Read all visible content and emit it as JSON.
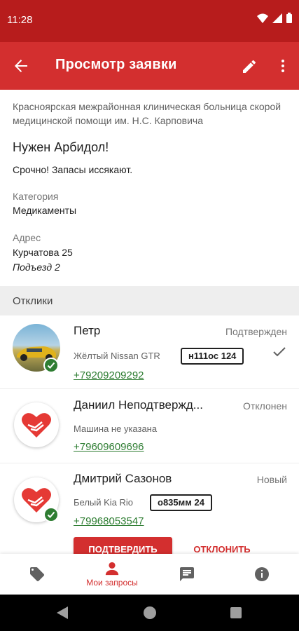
{
  "status_bar": {
    "time": "11:28"
  },
  "app_bar": {
    "title": "Просмотр заявки"
  },
  "request": {
    "organization": "Красноярская межрайонная клиническая больница скорой медицинской помощи им. Н.С. Карповича",
    "title": "Нужен Арбидол!",
    "description": "Срочно! Запасы иссякают.",
    "category_label": "Категория",
    "category": "Медикаменты",
    "address_label": "Адрес",
    "address": "Курчатова 25",
    "address_note": "Подъезд 2"
  },
  "responses_header": "Отклики",
  "responses": [
    {
      "name": "Петр",
      "status": "Подтвержден",
      "car": "Жёлтый Nissan GTR",
      "plate": "н111ос 124",
      "phone": "+79209209292",
      "avatar": "car-photo",
      "verified": true,
      "confirmed": true
    },
    {
      "name": "Даниил Неподтвержд...",
      "status": "Отклонен",
      "car": "Машина не указана",
      "phone": "+79609609696",
      "avatar": "heart-hands-icon",
      "verified": false
    },
    {
      "name": "Дмитрий Сазонов",
      "status": "Новый",
      "car": "Белый Kia Rio",
      "plate": "о835мм 24",
      "phone": "+79968053547",
      "avatar": "heart-hands-icon",
      "verified": true,
      "actions": {
        "confirm": "ПОДТВЕРДИТЬ",
        "reject": "ОТКЛОНИТЬ"
      }
    }
  ],
  "bottom_nav": [
    {
      "icon": "tag-icon",
      "label": ""
    },
    {
      "icon": "person-icon",
      "label": "Мои запросы",
      "active": true
    },
    {
      "icon": "chat-icon",
      "label": ""
    },
    {
      "icon": "info-icon",
      "label": ""
    }
  ],
  "colors": {
    "status_bar": "#b71c1c",
    "primary": "#d32f2f",
    "link_green": "#2e7d32",
    "section_bg": "#eeeeee"
  }
}
